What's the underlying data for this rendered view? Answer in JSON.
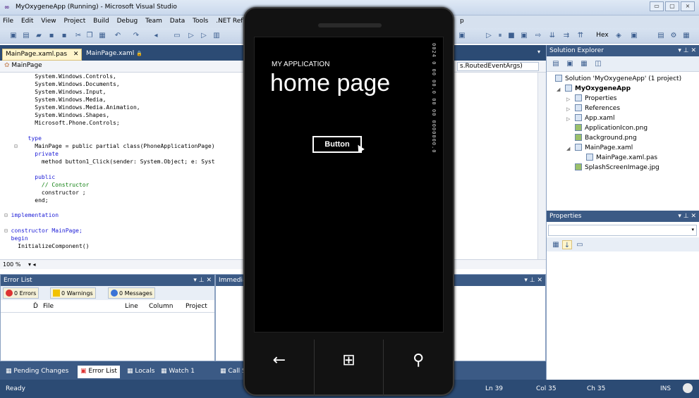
{
  "window": {
    "title": "MyOxygeneApp (Running) - Microsoft Visual Studio",
    "minimize": "▭",
    "maximize": "▢",
    "close": "⨯"
  },
  "menu": [
    "File",
    "Edit",
    "View",
    "Project",
    "Build",
    "Debug",
    "Team",
    "Data",
    "Tools",
    ".NET Refle",
    "p"
  ],
  "editor": {
    "tabs": [
      {
        "label": "MainPage.xaml.pas",
        "close": "✕"
      },
      {
        "label": "MainPage.xaml",
        "lock": "🔒"
      }
    ],
    "nav_left": "MainPage",
    "nav_right": "s.RoutedEventArgs)",
    "code_lines": [
      {
        "text": "    System.Windows.Controls,"
      },
      {
        "text": "    System.Windows.Documents,"
      },
      {
        "text": "    System.Windows.Input,"
      },
      {
        "text": "    System.Windows.Media,"
      },
      {
        "text": "    System.Windows.Media.Animation,"
      },
      {
        "text": "    System.Windows.Shapes,"
      },
      {
        "text": "    Microsoft.Phone.Controls;"
      },
      {
        "text": ""
      },
      {
        "text": "  type"
      },
      {
        "text": "    MainPage = public partial class(PhoneApplicationPage)"
      },
      {
        "text": "    private"
      },
      {
        "text": "      method button1_Click(sender: System.Object; e: Syst"
      },
      {
        "text": ""
      },
      {
        "text": "    public"
      },
      {
        "text": "      // Constructor"
      },
      {
        "text": "      constructor ;"
      },
      {
        "text": "    end;"
      },
      {
        "text": ""
      },
      {
        "text": "  implementation"
      },
      {
        "text": ""
      },
      {
        "text": "  constructor MainPage;"
      },
      {
        "text": "  begin"
      },
      {
        "text": "    InitializeComponent()"
      }
    ],
    "zoom": "100 %"
  },
  "error_list": {
    "title": "Error List",
    "pin": "▾ ⊥ ✕",
    "errors": "0 Errors",
    "warnings": "0 Warnings",
    "messages": "0 Messages",
    "columns": {
      "desc": "Ď",
      "file": "File",
      "line": "Line",
      "column": "Column",
      "project": "Project"
    }
  },
  "immediate": {
    "title": "Immediat"
  },
  "bottom_tabs": [
    "Pending Changes",
    "Error List",
    "Locals",
    "Watch 1",
    "Call S"
  ],
  "status": {
    "left": "Ready",
    "ln": "Ln 39",
    "col": "Col 35",
    "ch": "Ch 35",
    "ins": "INS"
  },
  "solution_explorer": {
    "title": "Solution Explorer",
    "pin": "▾ ⊥ ✕",
    "items": [
      {
        "label": "Solution 'MyOxygeneApp' (1 project)"
      },
      {
        "label": "MyOxygeneApp",
        "bold": true
      },
      {
        "label": "Properties"
      },
      {
        "label": "References"
      },
      {
        "label": "App.xaml"
      },
      {
        "label": "ApplicationIcon.png"
      },
      {
        "label": "Background.png"
      },
      {
        "label": "MainPage.xaml"
      },
      {
        "label": "MainPage.xaml.pas"
      },
      {
        "label": "SplashScreenImage.jpg"
      }
    ]
  },
  "properties": {
    "title": "Properties",
    "pin": "▾ ⊥ ✕"
  },
  "phone": {
    "app_name": "MY APPLICATION",
    "page_title": "home page",
    "button": "Button",
    "counter_text": "0024 0 00 00.0 00 00 0000000.0",
    "back": "←",
    "start": "⊞",
    "search": "⚲"
  }
}
